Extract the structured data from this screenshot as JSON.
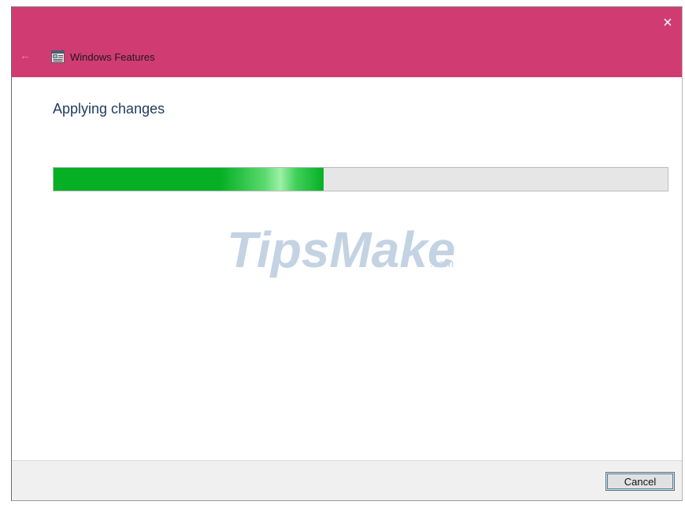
{
  "window": {
    "title": "Windows Features",
    "close_glyph": "×",
    "back_glyph": "←",
    "accent_color": "#d03c72"
  },
  "main": {
    "heading": "Applying changes",
    "progress": 0.44,
    "progress_color": "#06b025"
  },
  "watermark": {
    "brand": "TipsMake",
    "suffix": ".com"
  },
  "footer": {
    "cancel_label": "Cancel"
  },
  "icons": {
    "app": "windows-features-icon",
    "close": "close-icon",
    "back": "back-arrow-icon"
  }
}
